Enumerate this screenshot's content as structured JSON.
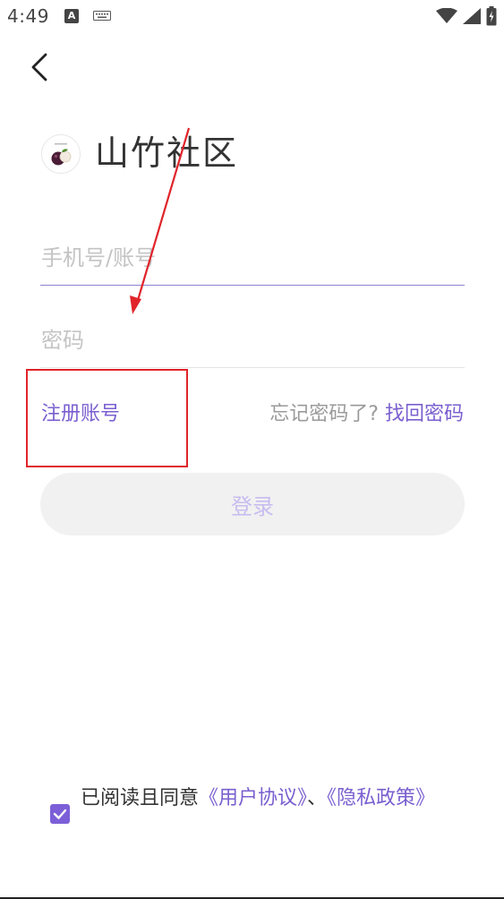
{
  "status_bar": {
    "time": "4:49",
    "notification_letter": "A"
  },
  "app": {
    "title": "山竹社区"
  },
  "form": {
    "account_placeholder": "手机号/账号",
    "password_placeholder": "密码",
    "register_label": "注册账号",
    "forgot_text": "忘记密码了?",
    "retrieve_label": "找回密码",
    "login_label": "登录"
  },
  "agreement": {
    "checked": true,
    "prefix": "已阅读且同意",
    "user_agreement": "《用户协议》",
    "separator": "、",
    "privacy_policy": "《隐私政策》"
  },
  "colors": {
    "accent": "#7a5fcf",
    "annotation": "#e0242a",
    "login_bg": "#f1f1f1"
  }
}
